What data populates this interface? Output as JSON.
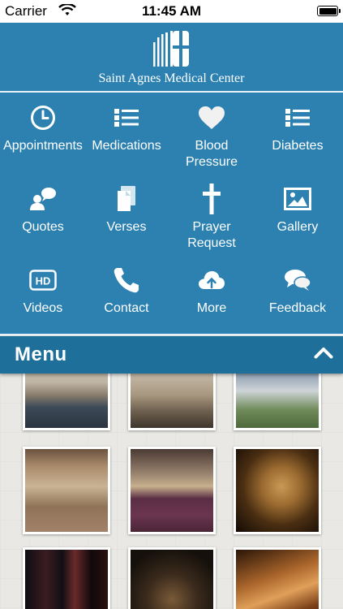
{
  "status_bar": {
    "carrier": "Carrier",
    "time": "11:45 AM",
    "battery_level_percent": 100
  },
  "header": {
    "logo_text": "Saint Agnes Medical Center"
  },
  "menu_items": [
    {
      "label": "Appointments",
      "icon": "clock-icon"
    },
    {
      "label": "Medications",
      "icon": "list-icon"
    },
    {
      "label": "Blood Pressure",
      "icon": "heart-icon"
    },
    {
      "label": "Diabetes",
      "icon": "list-icon"
    },
    {
      "label": "Quotes",
      "icon": "speech-person-icon"
    },
    {
      "label": "Verses",
      "icon": "pages-icon"
    },
    {
      "label": "Prayer Request",
      "icon": "cross-icon"
    },
    {
      "label": "Gallery",
      "icon": "image-icon"
    },
    {
      "label": "Videos",
      "icon": "hd-icon"
    },
    {
      "label": "Contact",
      "icon": "phone-icon"
    },
    {
      "label": "More",
      "icon": "cloud-upload-icon"
    },
    {
      "label": "Feedback",
      "icon": "chat-bubbles-icon"
    }
  ],
  "menu_bar": {
    "title": "Menu",
    "toggle_icon": "chevron-up-icon"
  },
  "colors": {
    "panel_blue": "#2c81b1",
    "menu_bar_blue": "#1f6f9b",
    "text_white": "#ffffff"
  }
}
